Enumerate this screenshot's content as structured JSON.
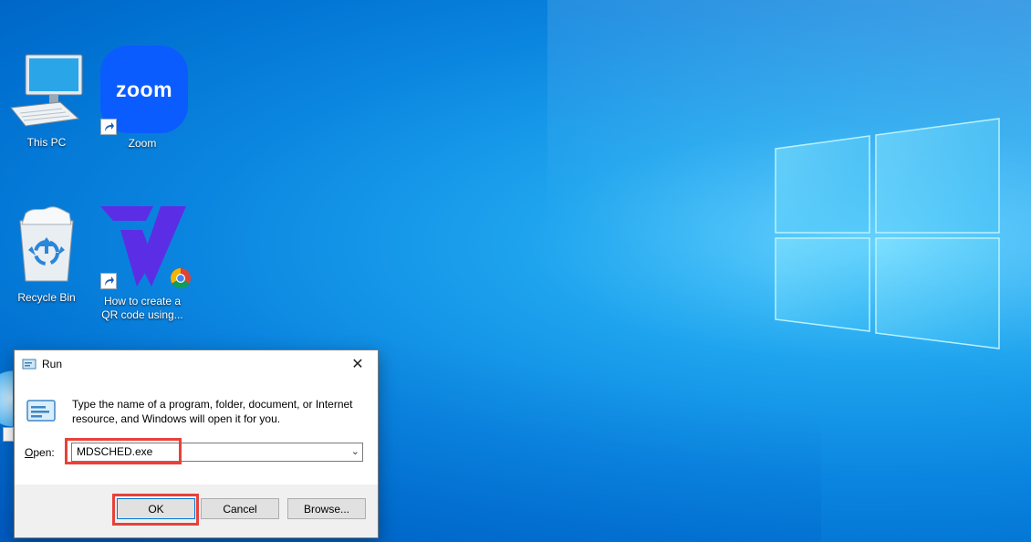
{
  "desktop": {
    "icons": [
      {
        "label": "This PC"
      },
      {
        "label": "Zoom",
        "logo_text": "zoom"
      },
      {
        "label": "Recycle Bin"
      },
      {
        "label_line1": "How to create a",
        "label_line2": "QR code using..."
      }
    ]
  },
  "run_dialog": {
    "title": "Run",
    "close_glyph": "✕",
    "description_line1": "Type the name of a program, folder, document, or Internet",
    "description_line2": "resource, and Windows will open it for you.",
    "open_label": "Open:",
    "open_value": "MDSCHED.exe",
    "ok_label": "OK",
    "cancel_label": "Cancel",
    "browse_label": "Browse...",
    "highlight_color": "#e8413a"
  },
  "colors": {
    "desktop_bg": "#0b86e0",
    "zoom_blue": "#0b5cff",
    "accent": "#0078d7"
  }
}
